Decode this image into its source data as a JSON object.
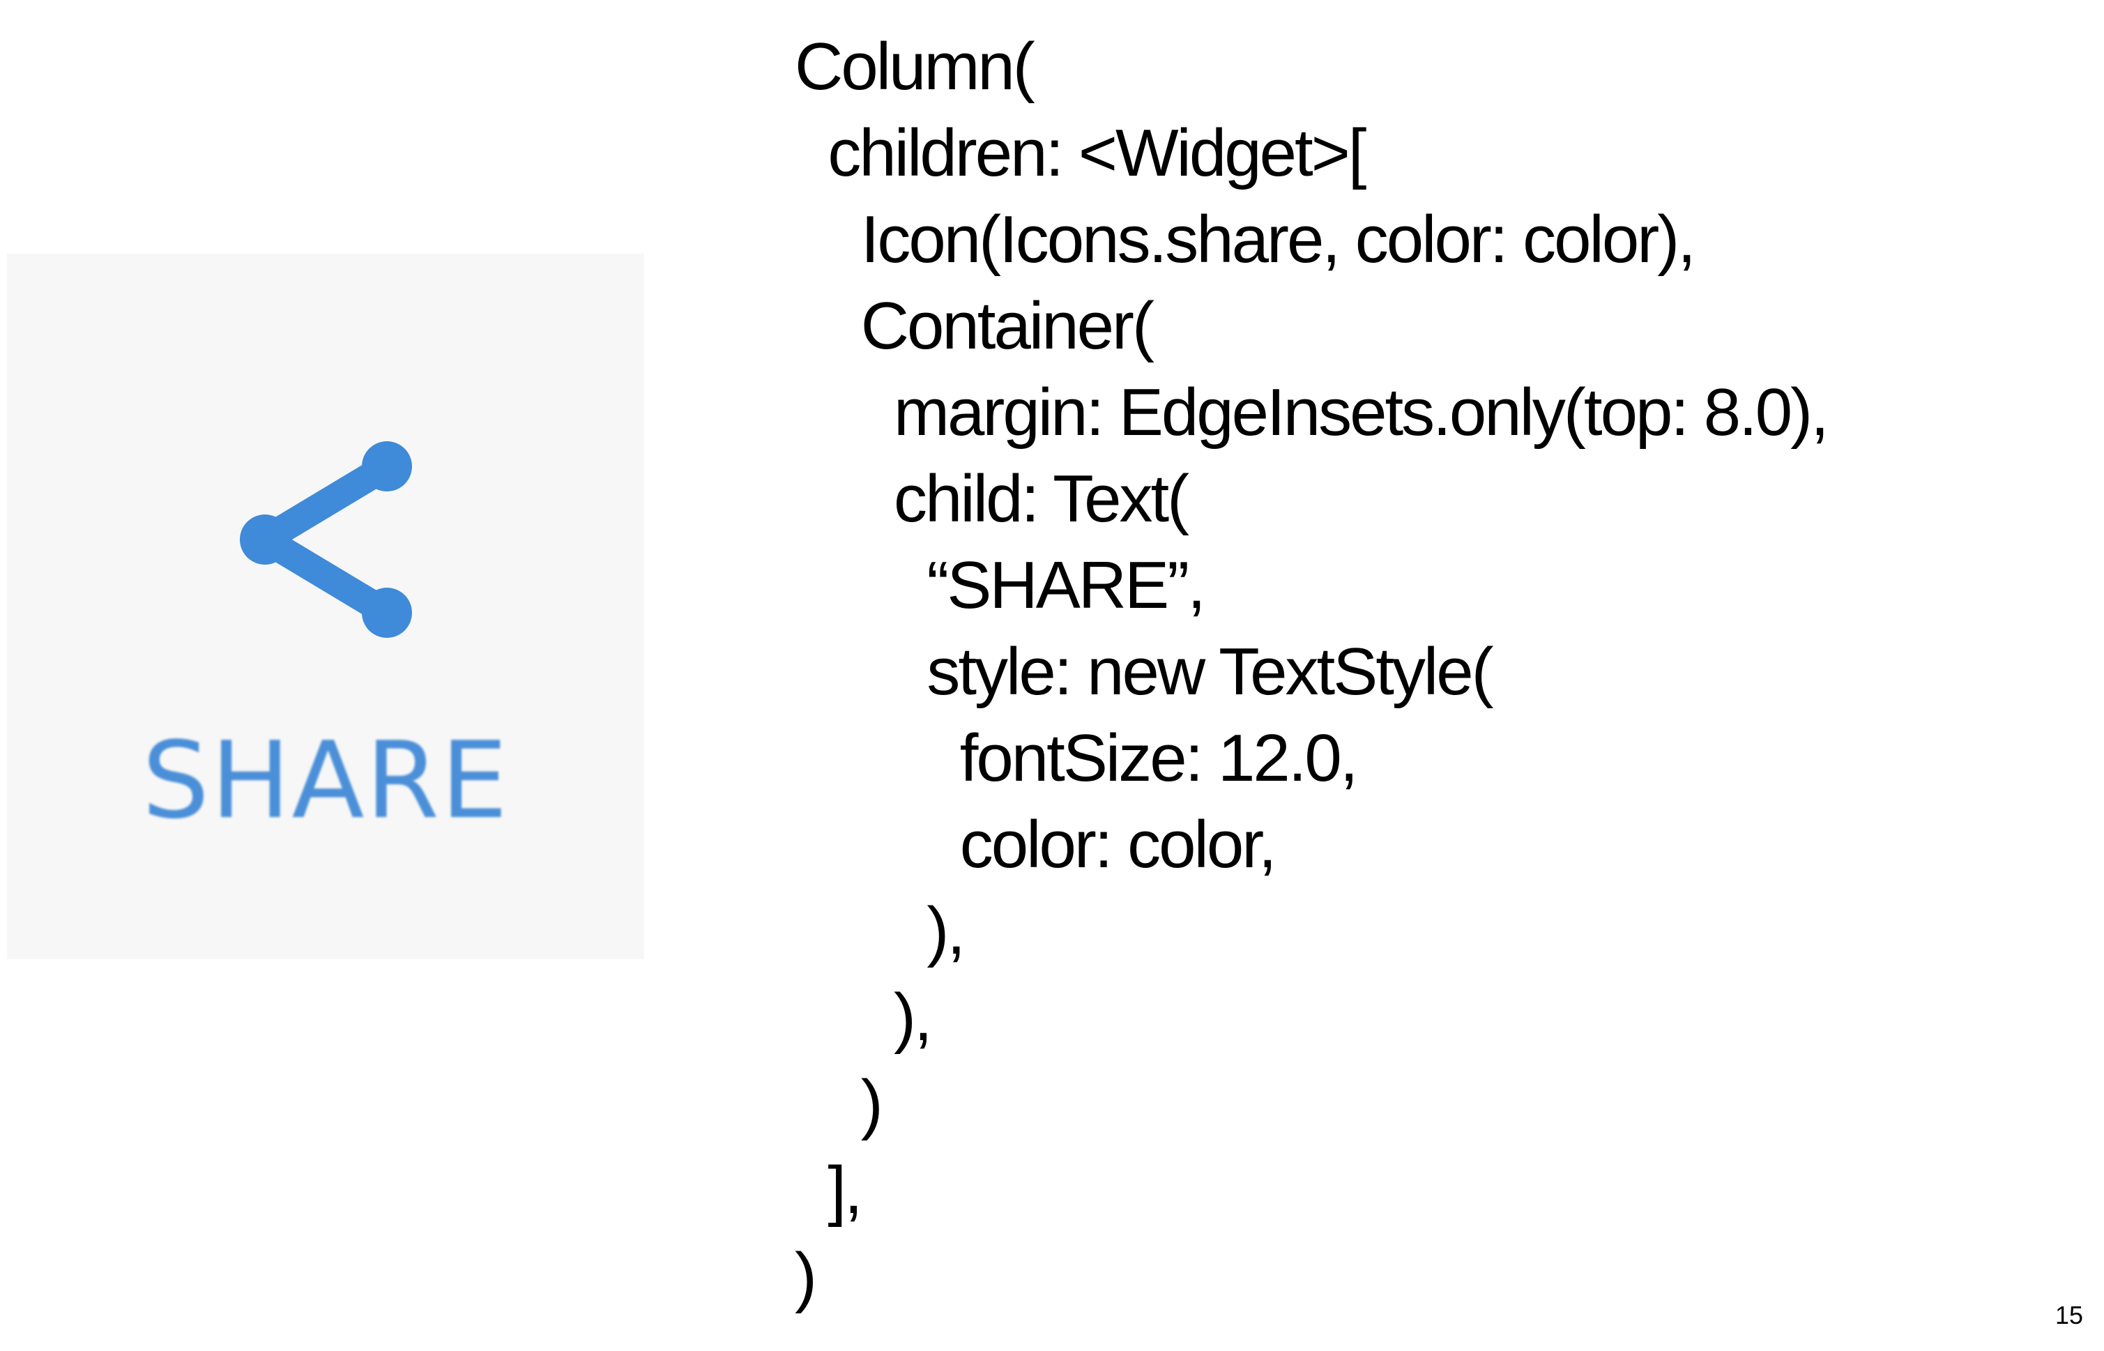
{
  "preview": {
    "icon": "share-icon",
    "label": "SHARE",
    "accent_color": "#4a90e2",
    "background_color": "#f7f7f7"
  },
  "code": {
    "lines": [
      "Column(",
      "  children: <Widget>[",
      "    Icon(Icons.share, color: color),",
      "    Container(",
      "      margin: EdgeInsets.only(top: 8.0),",
      "      child: Text(",
      "        “SHARE”,",
      "        style: new TextStyle(",
      "          fontSize: 12.0,",
      "          color: color,",
      "        ),",
      "      ),",
      "    )",
      "  ],",
      ")"
    ]
  },
  "slide": {
    "number": "15"
  }
}
